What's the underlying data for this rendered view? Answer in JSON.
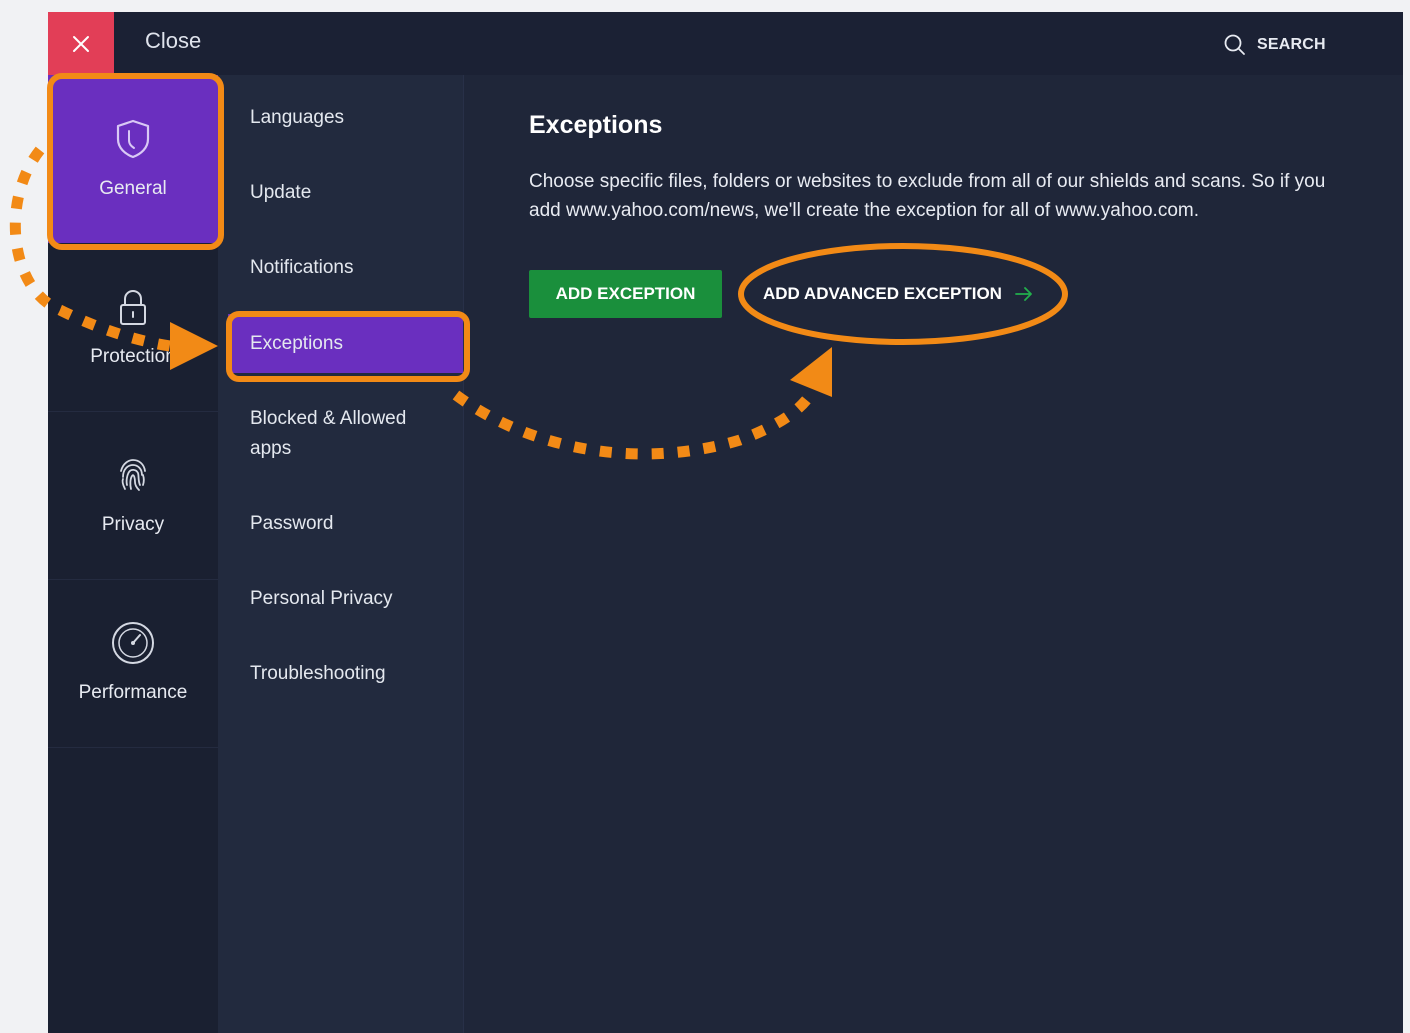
{
  "topbar": {
    "close_label": "Close",
    "close_icon": "close-icon",
    "search_label": "SEARCH",
    "search_icon": "search-icon"
  },
  "categories": [
    {
      "label": "General",
      "icon": "shield-icon",
      "selected": true
    },
    {
      "label": "Protection",
      "icon": "lock-icon",
      "selected": false
    },
    {
      "label": "Privacy",
      "icon": "fingerprint-icon",
      "selected": false
    },
    {
      "label": "Performance",
      "icon": "speedometer-icon",
      "selected": false
    }
  ],
  "submenu": [
    {
      "label": "Languages"
    },
    {
      "label": "Update"
    },
    {
      "label": "Notifications"
    },
    {
      "label": "Exceptions",
      "selected": true
    },
    {
      "label": "Blocked & Allowed apps"
    },
    {
      "label": "Password"
    },
    {
      "label": "Personal Privacy"
    },
    {
      "label": "Troubleshooting"
    }
  ],
  "content": {
    "title": "Exceptions",
    "description": "Choose specific files, folders or websites to exclude from all of our shields and scans. So if you add www.yahoo.com/news, we'll create the exception for all of www.yahoo.com.",
    "add_exception_label": "ADD EXCEPTION",
    "add_advanced_label": "ADD ADVANCED EXCEPTION",
    "add_advanced_icon": "arrow-right-icon"
  },
  "colors": {
    "background": "#1f2639",
    "accent_purple": "#6a2fbf",
    "close_red": "#e23e57",
    "button_green": "#1a8f3c",
    "annotation_orange": "#f28a16"
  }
}
